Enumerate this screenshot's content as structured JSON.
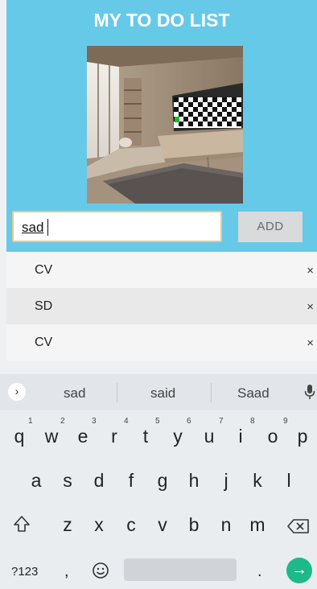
{
  "app": {
    "title": "MY TO DO LIST",
    "accent_color": "#67c9e8"
  },
  "form": {
    "input_value": "sad",
    "add_label": "ADD"
  },
  "todos": [
    {
      "label": "CV",
      "delete": "×"
    },
    {
      "label": "SD",
      "delete": "×"
    },
    {
      "label": "CV",
      "delete": "×"
    }
  ],
  "keyboard": {
    "suggestions": [
      "sad",
      "said",
      "Saad"
    ],
    "row1": [
      "q",
      "w",
      "e",
      "r",
      "t",
      "y",
      "u",
      "i",
      "o",
      "p"
    ],
    "row1_hints": [
      "1",
      "2",
      "3",
      "4",
      "5",
      "6",
      "7",
      "8",
      "9"
    ],
    "row2": [
      "a",
      "s",
      "d",
      "f",
      "g",
      "h",
      "j",
      "k",
      "l"
    ],
    "row3": [
      "z",
      "x",
      "c",
      "v",
      "b",
      "n",
      "m"
    ],
    "symbols_label": "?123",
    "comma": ",",
    "period": ".",
    "go_color": "#1db989"
  }
}
